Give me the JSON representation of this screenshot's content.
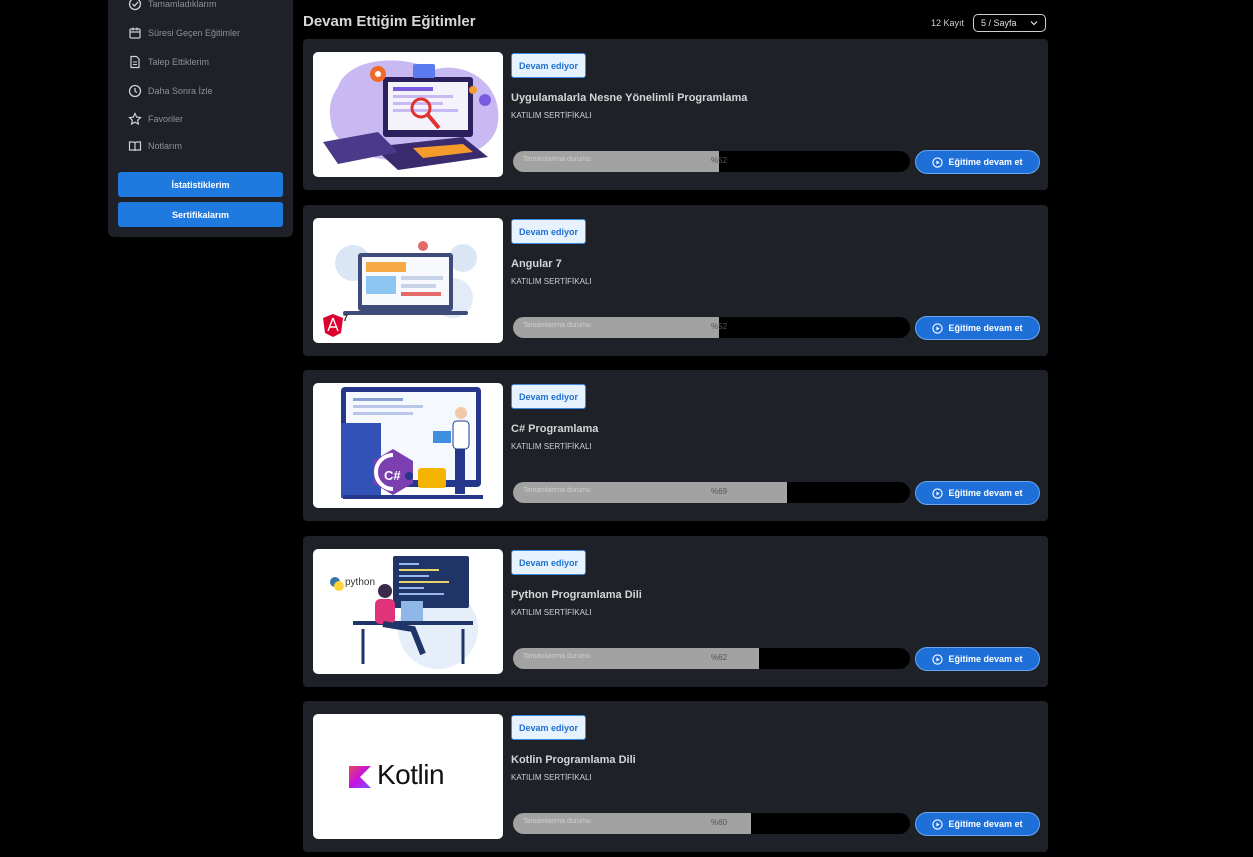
{
  "sidebar": {
    "items": [
      {
        "label": "Tamamladıklarım",
        "icon": "check-circle-icon"
      },
      {
        "label": "Süresi Geçen Eğitimler",
        "icon": "calendar-icon"
      },
      {
        "label": "Talep Ettiklerim",
        "icon": "document-icon"
      },
      {
        "label": "Daha Sonra İzle",
        "icon": "clock-icon"
      },
      {
        "label": "Favoriler",
        "icon": "star-icon"
      },
      {
        "label": "Notlarım",
        "icon": "book-icon"
      }
    ],
    "stats_button": "İstatistiklerim",
    "certs_button": "Sertifikalarım"
  },
  "header": {
    "title": "Devam Ettiğim Eğitimler",
    "count": "12 Kayıt",
    "page_size": "5 / Sayfa"
  },
  "courses": [
    {
      "status": "Devam ediyor",
      "title": "Uygulamalarla Nesne Yönelimli Programlama",
      "certificate": "KATILIM SERTİFİKALI",
      "progress_label": "Tamamlanma durumu",
      "progress_text": "%52",
      "progress": 52,
      "button": "Eğitime devam et",
      "image": "oop-illustration"
    },
    {
      "status": "Devam ediyor",
      "title": "Angular 7",
      "certificate": "KATILIM SERTİFİKALI",
      "progress_label": "Tamamlanma durumu",
      "progress_text": "%52",
      "progress": 52,
      "button": "Eğitime devam et",
      "image": "angular-illustration",
      "logo_text": "7"
    },
    {
      "status": "Devam ediyor",
      "title": "C# Programlama",
      "certificate": "KATILIM SERTİFİKALI",
      "progress_label": "Tamamlanma durumu",
      "progress_text": "%69",
      "progress": 69,
      "button": "Eğitime devam et",
      "image": "csharp-illustration",
      "logo_text": "C#"
    },
    {
      "status": "Devam ediyor",
      "title": "Python Programlama Dili",
      "certificate": "KATILIM SERTİFİKALI",
      "progress_label": "Tamamlanma durumu",
      "progress_text": "%62",
      "progress": 62,
      "button": "Eğitime devam et",
      "image": "python-illustration",
      "logo_text": "python"
    },
    {
      "status": "Devam ediyor",
      "title": "Kotlin Programlama Dili",
      "certificate": "KATILIM SERTİFİKALI",
      "progress_label": "Tamamlanma durumu",
      "progress_text": "%60",
      "progress": 60,
      "button": "Eğitime devam et",
      "image": "kotlin-logo",
      "logo_text": "Kotlin"
    }
  ],
  "colors": {
    "accent": "#1f7ae0",
    "card_bg": "#1e2128",
    "badge_bg": "#e6f3ff",
    "progress_fill": "#a2a2a2"
  }
}
